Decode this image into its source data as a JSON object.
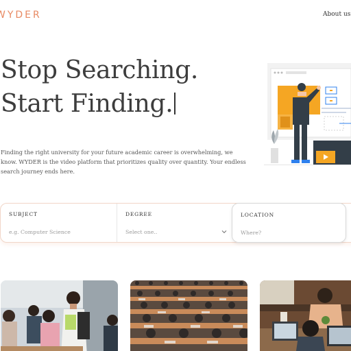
{
  "header": {
    "logo": "WYDER",
    "nav": {
      "about": "About us"
    }
  },
  "hero": {
    "headline_line1": "Stop Searching.",
    "headline_line2": "Start Finding.",
    "intro": "Finding the right university for your future academic career is overwhelming, we know. WYDER is the video platform that prioritizes quality over quantity. Your endless search journey ends here."
  },
  "search": {
    "subject": {
      "label": "SUBJECT",
      "placeholder": "e.g. Computer Science"
    },
    "degree": {
      "label": "DEGREE",
      "selected": "Select one.."
    },
    "location": {
      "label": "LOCATION",
      "placeholder": "Where?"
    }
  },
  "colors": {
    "brand": "#e88a63",
    "illustration_accent": "#f5a623",
    "illustration_dark": "#333e48",
    "illustration_blue": "#2f80ed"
  },
  "icons": {
    "illustration": "person-at-board-illustration",
    "dropdown": "chevron-down-icon"
  }
}
